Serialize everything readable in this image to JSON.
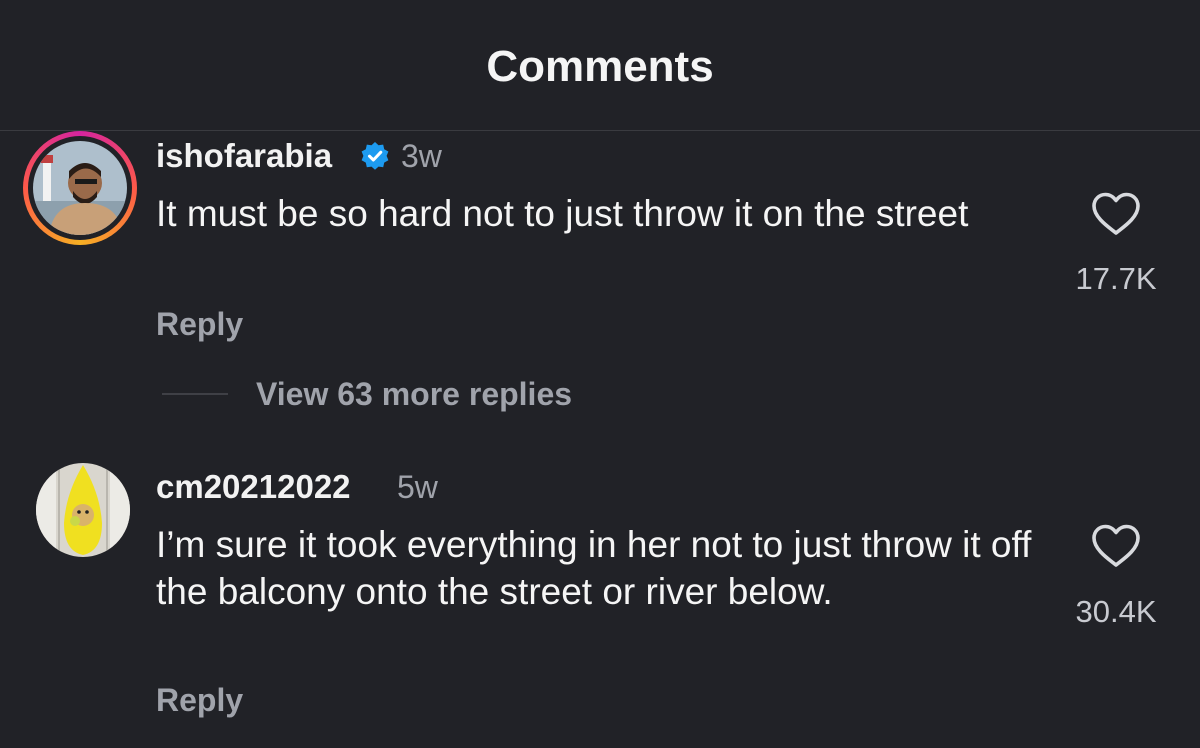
{
  "header": {
    "title": "Comments"
  },
  "comments": [
    {
      "username": "ishofarabia",
      "verified": true,
      "time": "3w",
      "text": "It must be so hard not to just throw it on the street",
      "reply_label": "Reply",
      "likes": "17.7K",
      "view_more": "View 63 more replies",
      "has_story_ring": true
    },
    {
      "username": "cm20212022",
      "verified": false,
      "time": "5w",
      "text": "I’m sure it took everything in her not to just throw it off the balcony onto the street or river below.",
      "reply_label": "Reply",
      "likes": "30.4K",
      "has_story_ring": false
    }
  ],
  "colors": {
    "background": "#212227",
    "verified_badge": "#1d9bf0",
    "secondary_text": "#a0a3ab"
  },
  "icons": {
    "like": "heart-outline-icon",
    "verified": "verified-badge-icon"
  }
}
